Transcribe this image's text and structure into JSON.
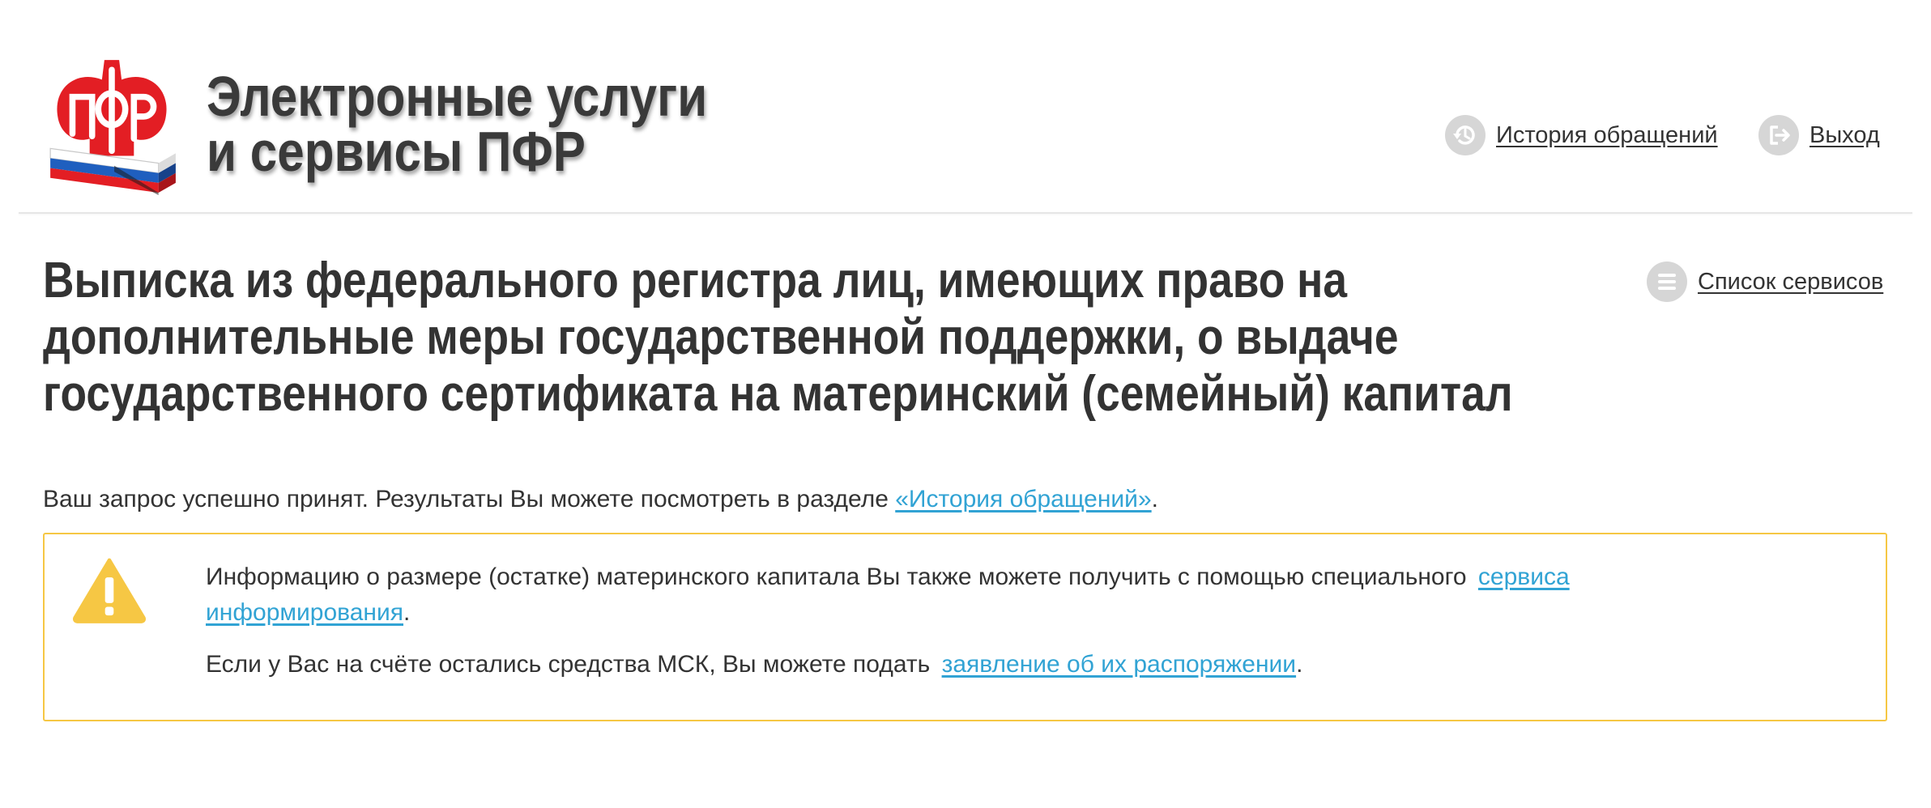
{
  "header": {
    "logo": {
      "icon": "pfr-logo",
      "lettering": "ПФР"
    },
    "title_line1": "Электронные услуги",
    "title_line2": "и сервисы ПФР",
    "nav": {
      "history_label": "История обращений",
      "history_icon": "history-icon",
      "logout_label": "Выход",
      "logout_icon": "logout-icon"
    }
  },
  "main": {
    "page_title": "Выписка из федерального регистра лиц, имеющих право на дополнительные меры государственной поддержки, о выдаче государственного сертификата на материнский (семейный) капитал",
    "services_link": {
      "label": "Список сервисов",
      "icon": "list-icon"
    },
    "status": {
      "text": "Ваш запрос успешно принят. Результаты Вы можете посмотреть в разделе ",
      "link": "«История обращений»",
      "suffix": "."
    },
    "notice": {
      "icon": "warning-icon",
      "p1": {
        "text": "Информацию о размере (остатке) материнского капитала Вы также можете получить с помощью специального ",
        "link": "сервиса информирования",
        "suffix": "."
      },
      "p2": {
        "text": "Если у Вас на счёте остались средства МСК, Вы можете подать ",
        "link": "заявление об их распоряжении",
        "suffix": "."
      }
    }
  },
  "colors": {
    "text": "#333333",
    "link": "#31a3d4",
    "notice_border": "#f6c744",
    "icon_bg": "#d6d6d6",
    "logo_red": "#e31e24",
    "flag_blue": "#1f5fbf"
  }
}
